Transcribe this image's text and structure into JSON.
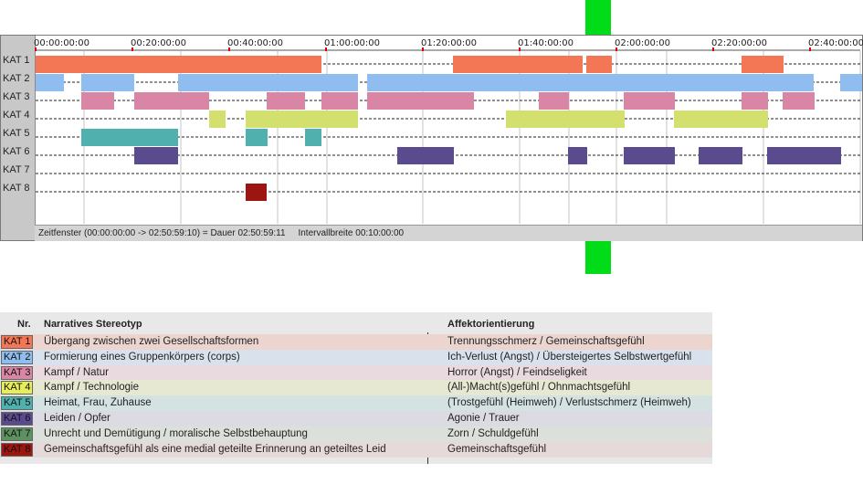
{
  "timeline": {
    "ticks": [
      "00:00:00:00",
      "00:20:00:00",
      "00:40:00:00",
      "01:00:00:00",
      "01:20:00:00",
      "01:40:00:00",
      "02:00:00:00",
      "02:20:00:00",
      "02:40:00:00"
    ],
    "rows": [
      {
        "label": "KAT 1",
        "color": "#f47755"
      },
      {
        "label": "KAT 2",
        "color": "#8fbdef"
      },
      {
        "label": "KAT 3",
        "color": "#d985a5"
      },
      {
        "label": "KAT 4",
        "color": "#d4e06e"
      },
      {
        "label": "KAT 5",
        "color": "#4fb0ae"
      },
      {
        "label": "KAT 6",
        "color": "#5a4b8e"
      },
      {
        "label": "KAT 7",
        "color": "#5d9160"
      },
      {
        "label": "KAT 8",
        "color": "#9c1511"
      }
    ],
    "status": "Zeitfenster (00:00:00:00 -> 02:50:59:10) = Dauer 02:50:59:11     Intervallbreite 00:10:00:00",
    "playhead_color": "#00dd18"
  },
  "legend": {
    "headers": {
      "nr": "Nr.",
      "stereotype": "Narratives Stereotyp",
      "affect": "Affektorientierung"
    },
    "rows": [
      {
        "nr": "KAT 1",
        "stereotype": "Übergang zwischen zwei Gesellschaftsformen",
        "affect": "Trennungsschmerz / Gemeinschaftsgefühl",
        "color": "#f47755",
        "bg": "#ecd4cf"
      },
      {
        "nr": "KAT 2",
        "stereotype": "Formierung eines Gruppenkörpers (corps)",
        "affect": "Ich-Verlust (Angst) / Übersteigertes Selbstwertgefühl",
        "color": "#8fbdef",
        "bg": "#d9e1ec"
      },
      {
        "nr": "KAT 3",
        "stereotype": "Kampf / Natur",
        "affect": "Horror (Angst) / Feindseligkeit",
        "color": "#d985a5",
        "bg": "#e9dadf"
      },
      {
        "nr": "KAT 4",
        "stereotype": "Kampf / Technologie",
        "affect": "(All-)Macht(s)gefühl / Ohnmachtsgefühl",
        "color": "#e8ee5a",
        "bg": "#e6e8d2"
      },
      {
        "nr": "KAT 5",
        "stereotype": "Heimat, Frau, Zuhause",
        "affect": "(Trostgefühl (Heimweh) / Verlustschmerz (Heimweh)",
        "color": "#4fb0ae",
        "bg": "#d4e3e2"
      },
      {
        "nr": "KAT 6",
        "stereotype": "Leiden / Opfer",
        "affect": "Agonie / Trauer",
        "color": "#5a4b8e",
        "bg": "#dcdae3"
      },
      {
        "nr": "KAT 7",
        "stereotype": "Unrecht und Demütigung / moralische Selbstbehauptung",
        "affect": "Zorn / Schuldgefühl",
        "color": "#5d9160",
        "bg": "#dbe1da"
      },
      {
        "nr": "KAT 8",
        "stereotype": "Gemeinschaftsgefühl als eine medial geteilte Erinnerung an geteiltes Leid",
        "affect": "Gemeinschaftsgefühl",
        "color": "#9c1511",
        "bg": "#e6d9d9"
      }
    ]
  }
}
